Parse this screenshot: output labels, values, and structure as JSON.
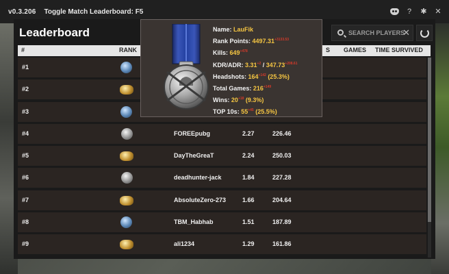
{
  "topbar": {
    "version": "v0.3.206",
    "toggle_hint": "Toggle Match Leaderboard: F5",
    "icons": [
      "discord-icon",
      "help-icon",
      "gear-icon",
      "close-icon"
    ],
    "help_glyph": "?",
    "gear_glyph": "✱",
    "close_glyph": "✕"
  },
  "panel": {
    "title": "Leaderboard",
    "search_placeholder": "SEARCH PLAYERS",
    "clear_glyph": "✕"
  },
  "columns": {
    "num": "#",
    "rank": "RANK",
    "games": "GAMES",
    "time_survived": "TIME SURVIVED",
    "partial": "S"
  },
  "rows": [
    {
      "num": "#1",
      "rank_tier": "blue",
      "name": "",
      "kdr": "",
      "adr": ""
    },
    {
      "num": "#2",
      "rank_tier": "gold",
      "name": "",
      "kdr": "",
      "adr": ""
    },
    {
      "num": "#3",
      "rank_tier": "blue",
      "name": "",
      "kdr": "",
      "adr": ""
    },
    {
      "num": "#4",
      "rank_tier": "silver",
      "name": "FOREEpubg",
      "kdr": "2.27",
      "adr": "226.46"
    },
    {
      "num": "#5",
      "rank_tier": "gold",
      "name": "DayTheGreaT",
      "kdr": "2.24",
      "adr": "250.03"
    },
    {
      "num": "#6",
      "rank_tier": "silver",
      "name": "deadhunter-jack",
      "kdr": "1.84",
      "adr": "227.28"
    },
    {
      "num": "#7",
      "rank_tier": "gold",
      "name": "AbsoluteZero-273",
      "kdr": "1.66",
      "adr": "204.64"
    },
    {
      "num": "#8",
      "rank_tier": "blue",
      "name": "TBM_Habhab",
      "kdr": "1.51",
      "adr": "187.89"
    },
    {
      "num": "#9",
      "rank_tier": "gold",
      "name": "ali1234",
      "kdr": "1.29",
      "adr": "161.86"
    }
  ],
  "tooltip": {
    "name_label": "Name: ",
    "name": "LauFik",
    "rank_points_label": "Rank Points: ",
    "rank_points": "4497.31",
    "rank_points_delta": "+3133.53",
    "kills_label": "Kills: ",
    "kills": "649",
    "kills_delta": "+478",
    "kdr_adr_label": "KDR/ADR: ",
    "kdr": "3.31",
    "kdr_delta": "+2",
    "adr_sep": " / ",
    "adr": "347.73",
    "adr_delta": "+208.61",
    "headshots_label": "Headshots: ",
    "headshots": "164",
    "headshots_delta": "+142",
    "headshots_pct": " (25.3%)",
    "total_games_label": "Total Games: ",
    "total_games": "216",
    "total_games_delta": "+149",
    "wins_label": "Wins: ",
    "wins": "20",
    "wins_delta": "+18",
    "wins_pct": " (9.3%)",
    "top10_label": "TOP 10s: ",
    "top10": "55",
    "top10_delta": "+45",
    "top10_pct": " (25.5%)"
  },
  "colors": {
    "accent_yellow": "#f5c542",
    "delta_red": "#d43a2a",
    "row_bg": "#2b2522"
  }
}
